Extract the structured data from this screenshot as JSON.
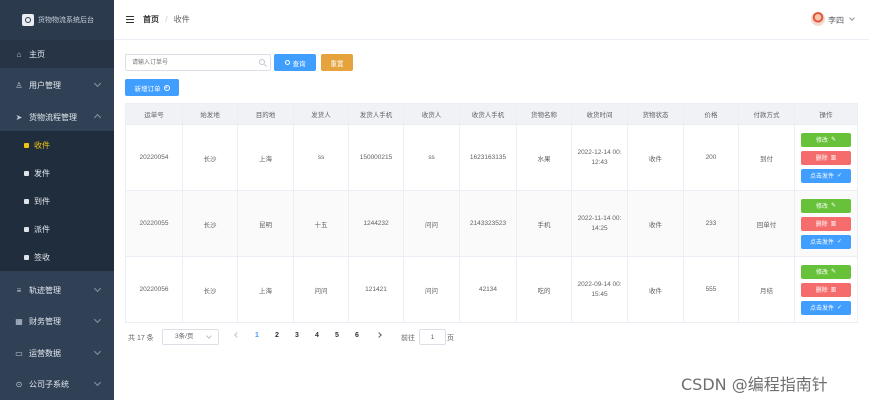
{
  "brand": {
    "title": "货物物流系统后台"
  },
  "sidebar": {
    "items": [
      {
        "label": "主页",
        "icon": "home-icon"
      },
      {
        "label": "用户管理",
        "icon": "user-icon"
      },
      {
        "label": "货物流程管理",
        "icon": "send-icon"
      },
      {
        "label": "轨迹管理",
        "icon": "sliders-icon"
      },
      {
        "label": "财务管理",
        "icon": "chart-icon"
      },
      {
        "label": "运营数据",
        "icon": "monitor-icon"
      },
      {
        "label": "公司子系统",
        "icon": "link-icon"
      }
    ],
    "subitems": [
      {
        "label": "收件"
      },
      {
        "label": "发件"
      },
      {
        "label": "到件"
      },
      {
        "label": "派件"
      },
      {
        "label": "签收"
      }
    ]
  },
  "header": {
    "breadcrumb_home": "首页",
    "breadcrumb_separator": "/",
    "breadcrumb_current": "收件",
    "username": "李四"
  },
  "toolbar": {
    "search_placeholder": "请输入订单号",
    "query_label": "查询",
    "reset_label": "重置",
    "add_label": "新增订单"
  },
  "table": {
    "columns": [
      "运单号",
      "始发地",
      "目的地",
      "发货人",
      "发货人手机",
      "收货人",
      "收货人手机",
      "货物名称",
      "收货时间",
      "货物状态",
      "价格",
      "付款方式",
      "操作"
    ],
    "rows": [
      {
        "id": "20220054",
        "origin": "长沙",
        "dest": "上海",
        "sender": "ss",
        "sender_phone": "150000215",
        "receiver": "ss",
        "receiver_phone": "1623163135",
        "goods": "水果",
        "time_date": "2022-12-14 00:",
        "time_clock": "12:43",
        "status": "收件",
        "price": "200",
        "payment": "到付"
      },
      {
        "id": "20220055",
        "origin": "长沙",
        "dest": "昆明",
        "sender": "十五",
        "sender_phone": "1244232",
        "receiver": "问问",
        "receiver_phone": "2143323523",
        "goods": "手机",
        "time_date": "2022-11-14 00:",
        "time_clock": "14:25",
        "status": "收件",
        "price": "233",
        "payment": "回单付"
      },
      {
        "id": "20220056",
        "origin": "长沙",
        "dest": "上海",
        "sender": "问问",
        "sender_phone": "121421",
        "receiver": "问问",
        "receiver_phone": "42134",
        "goods": "吃的",
        "time_date": "2022-09-14 00:",
        "time_clock": "15:45",
        "status": "收件",
        "price": "555",
        "payment": "月结"
      }
    ],
    "actions": {
      "edit": "修改",
      "delete": "删除",
      "ship": "点击发件"
    }
  },
  "pagination": {
    "total": "共 17 条",
    "page_size": "3条/页",
    "pages": [
      "1",
      "2",
      "3",
      "4",
      "5",
      "6"
    ],
    "current_page": "1",
    "goto_label": "前往",
    "goto_value": "1",
    "page_unit": "页"
  },
  "watermark": "CSDN @编程指南针",
  "colors": {
    "sidebar": "#304156",
    "primary": "#409eff",
    "success": "#67c23a",
    "danger": "#f56c6c",
    "warning": "#e6a23c",
    "active_sub": "#f1c40f"
  }
}
